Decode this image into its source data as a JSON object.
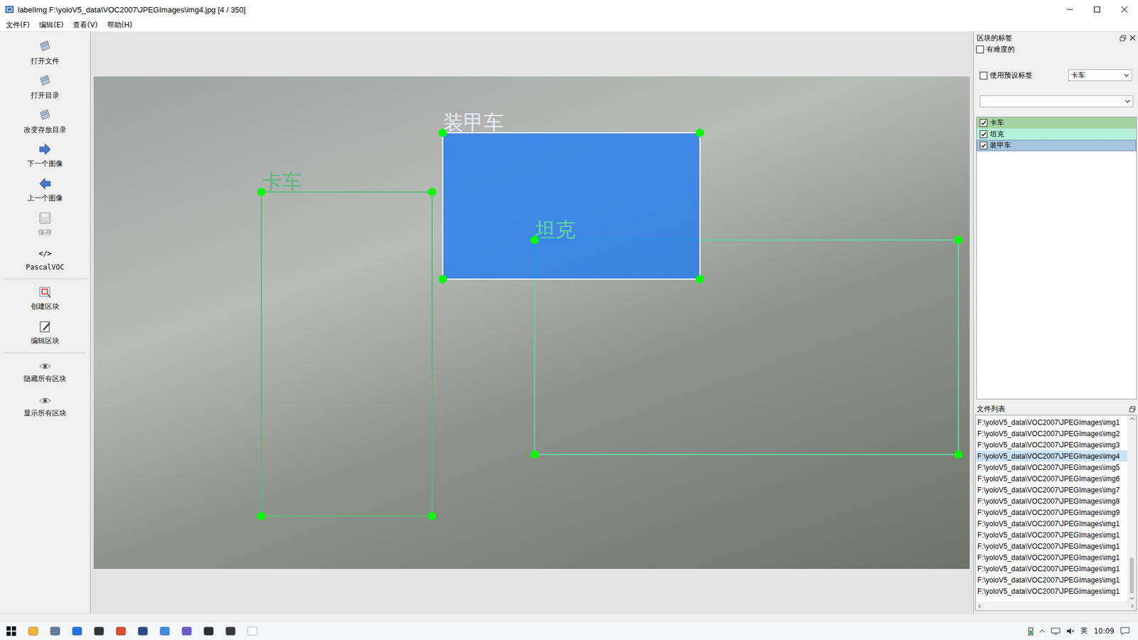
{
  "window": {
    "title": "labelImg F:\\yoloV5_data\\VOC2007\\JPEGImages\\img4.jpg [4 / 350]"
  },
  "menu": [
    "文件(F)",
    "编辑(E)",
    "查看(V)",
    "帮助(H)"
  ],
  "toolbar": [
    {
      "label": "打开文件",
      "kind": "icon",
      "disabled": false
    },
    {
      "label": "打开目录",
      "kind": "icon",
      "disabled": false
    },
    {
      "label": "改变存放目录",
      "kind": "icon",
      "disabled": false
    },
    {
      "label": "下一个图像",
      "kind": "icon",
      "disabled": false
    },
    {
      "label": "上一个图像",
      "kind": "icon",
      "disabled": false
    },
    {
      "label": "保存",
      "kind": "icon",
      "disabled": true
    },
    {
      "label": "PascalVOC",
      "kind": "glyph",
      "glyph": "</>",
      "disabled": false
    },
    {
      "label": "创建区块",
      "kind": "icon",
      "disabled": false
    },
    {
      "label": "编辑区块",
      "kind": "icon",
      "disabled": false
    },
    {
      "label": "隐藏所有区块",
      "kind": "icon",
      "disabled": false
    },
    {
      "label": "显示所有区块",
      "kind": "icon",
      "disabled": false
    }
  ],
  "canvas": {
    "shapes": [
      {
        "label": "卡车",
        "selected": false,
        "color": "#5cb878"
      },
      {
        "label": "坦克",
        "selected": false,
        "color": "#5fd6a2"
      },
      {
        "label": "装甲车",
        "selected": true,
        "color": "#1f7cf2"
      }
    ]
  },
  "labels_panel": {
    "title": "区块的标签",
    "difficult": {
      "label": "有难度的",
      "checked": false
    },
    "use_default": {
      "label": "使用预设标签",
      "checked": false,
      "value": "卡车"
    },
    "filter_value": "",
    "labels": [
      {
        "label": "卡车",
        "checked": true,
        "selected": false,
        "color": "#a6d3a3"
      },
      {
        "label": "坦克",
        "checked": true,
        "selected": false,
        "color": "#b4f2da"
      },
      {
        "label": "装甲车",
        "checked": true,
        "selected": true,
        "color": "#a9c6df"
      }
    ]
  },
  "file_panel": {
    "title": "文件列表",
    "files": [
      {
        "path": "F:\\yoloV5_data\\VOC2007\\JPEGImages\\img1",
        "selected": false
      },
      {
        "path": "F:\\yoloV5_data\\VOC2007\\JPEGImages\\img2",
        "selected": false
      },
      {
        "path": "F:\\yoloV5_data\\VOC2007\\JPEGImages\\img3",
        "selected": false
      },
      {
        "path": "F:\\yoloV5_data\\VOC2007\\JPEGImages\\img4",
        "selected": true
      },
      {
        "path": "F:\\yoloV5_data\\VOC2007\\JPEGImages\\img5",
        "selected": false
      },
      {
        "path": "F:\\yoloV5_data\\VOC2007\\JPEGImages\\img6",
        "selected": false
      },
      {
        "path": "F:\\yoloV5_data\\VOC2007\\JPEGImages\\img7",
        "selected": false
      },
      {
        "path": "F:\\yoloV5_data\\VOC2007\\JPEGImages\\img8",
        "selected": false
      },
      {
        "path": "F:\\yoloV5_data\\VOC2007\\JPEGImages\\img9",
        "selected": false
      },
      {
        "path": "F:\\yoloV5_data\\VOC2007\\JPEGImages\\img1",
        "selected": false
      },
      {
        "path": "F:\\yoloV5_data\\VOC2007\\JPEGImages\\img1",
        "selected": false
      },
      {
        "path": "F:\\yoloV5_data\\VOC2007\\JPEGImages\\img1",
        "selected": false
      },
      {
        "path": "F:\\yoloV5_data\\VOC2007\\JPEGImages\\img1",
        "selected": false
      },
      {
        "path": "F:\\yoloV5_data\\VOC2007\\JPEGImages\\img1",
        "selected": false
      },
      {
        "path": "F:\\yoloV5_data\\VOC2007\\JPEGImages\\img1",
        "selected": false
      },
      {
        "path": "F:\\yoloV5_data\\VOC2007\\JPEGImages\\img1",
        "selected": false
      }
    ]
  },
  "taskbar": {
    "ime": "英",
    "time": "10:09"
  }
}
